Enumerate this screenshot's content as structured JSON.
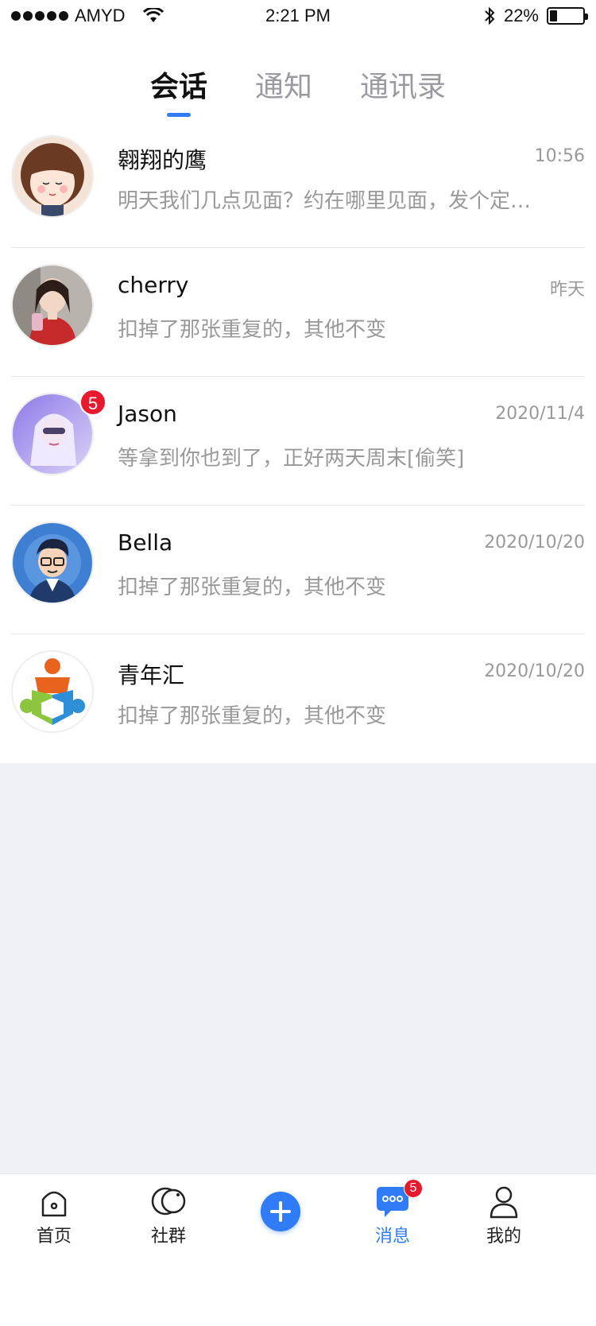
{
  "status_bar": {
    "carrier": "AMYD",
    "time": "2:21 PM",
    "battery_text": "22%",
    "battery_level": 0.22
  },
  "tabs": [
    {
      "label": "会话",
      "active": true
    },
    {
      "label": "通知",
      "active": false
    },
    {
      "label": "通讯录",
      "active": false
    }
  ],
  "conversations": [
    {
      "name": "翱翔的鹰",
      "time": "10:56",
      "preview": "明天我们几点见面？约在哪里见面，发个定位吧",
      "unread": ""
    },
    {
      "name": "cherry",
      "time": "昨天",
      "preview": "扣掉了那张重复的，其他不变",
      "unread": ""
    },
    {
      "name": "Jason",
      "time": "2020/11/4",
      "preview": "等拿到你也到了，正好两天周末[偷笑]",
      "unread": "5"
    },
    {
      "name": "Bella",
      "time": "2020/10/20",
      "preview": "扣掉了那张重复的，其他不变",
      "unread": ""
    },
    {
      "name": "青年汇",
      "time": "2020/10/20",
      "preview": "扣掉了那张重复的，其他不变",
      "unread": ""
    }
  ],
  "bottom_nav": {
    "home": "首页",
    "community": "社群",
    "messages": "消息",
    "messages_badge": "5",
    "mine": "我的"
  },
  "colors": {
    "accent": "#2f7cf6",
    "badge": "#e8192c",
    "background": "#f0f1f5"
  }
}
